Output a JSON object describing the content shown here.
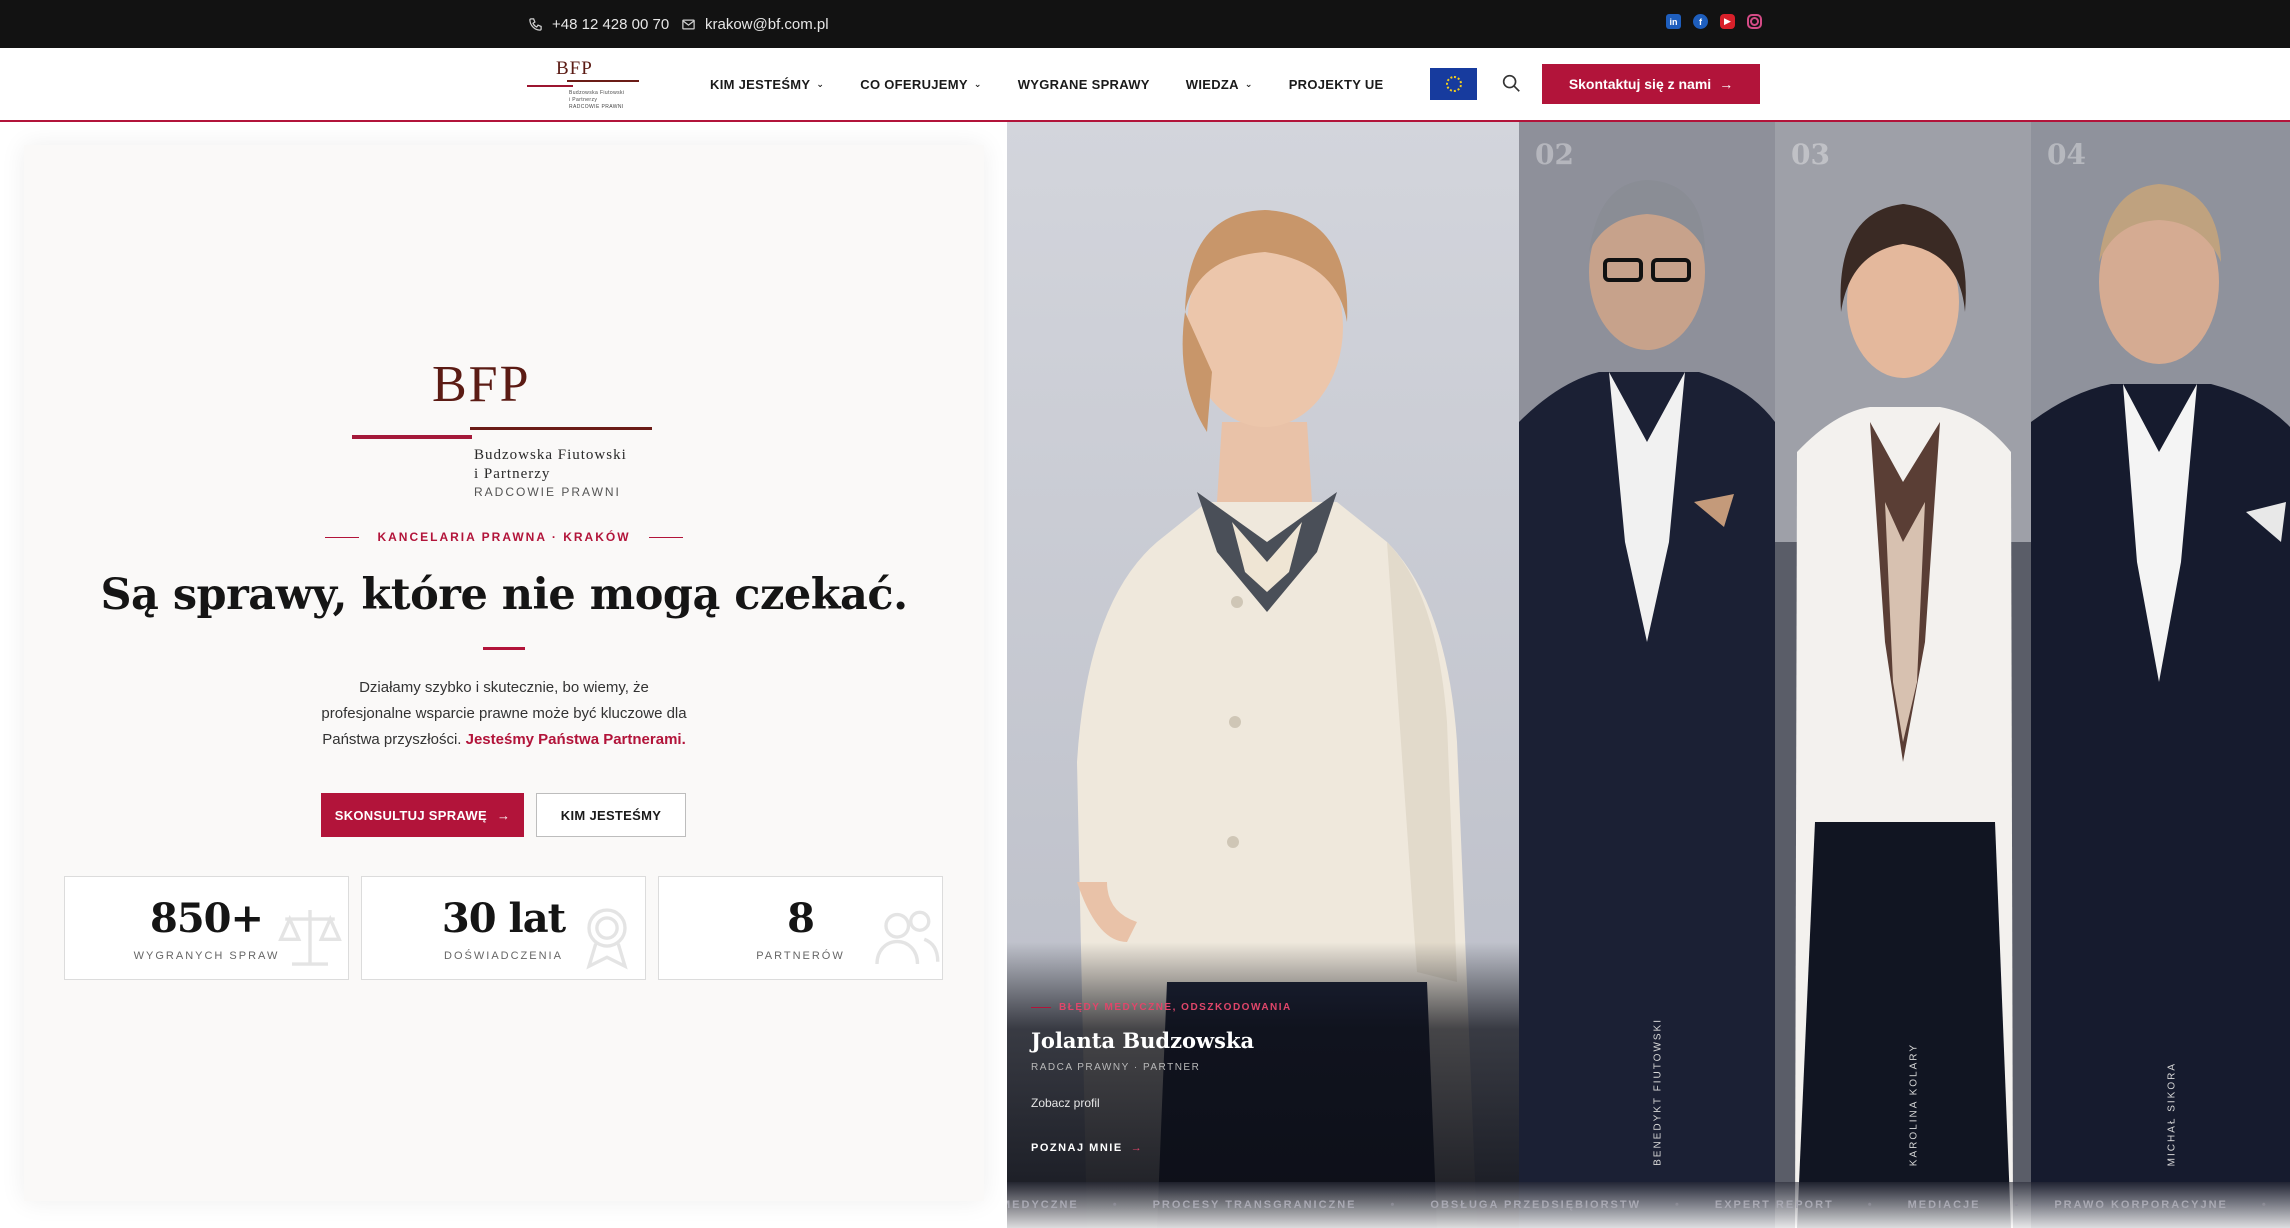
{
  "topbar": {
    "phone": "+48 12 428 00 70",
    "email": "krakow@bf.com.pl",
    "socials": [
      "linkedin-icon",
      "facebook-icon",
      "youtube-icon",
      "instagram-icon"
    ]
  },
  "nav": {
    "logo_mono": "BFP",
    "items": [
      {
        "label": "KIM JESTEŚMY",
        "dropdown": true
      },
      {
        "label": "CO OFERUJEMY",
        "dropdown": true
      },
      {
        "label": "WYGRANE SPRAWY",
        "dropdown": false
      },
      {
        "label": "WIEDZA",
        "dropdown": true
      },
      {
        "label": "PROJEKTY UE",
        "dropdown": false
      }
    ],
    "cta_label": "Skontaktuj się z nami"
  },
  "hero": {
    "logo_mono": "BFP",
    "logo_name1": "Budzowska Fiutowski",
    "logo_name2": "i Partnerzy",
    "logo_name3": "RADCOWIE PRAWNI",
    "eyebrow": "KANCELARIA PRAWNA · KRAKÓW",
    "headline": "Są sprawy, które nie mogą czekać.",
    "lead_text": "Działamy szybko i skutecznie, bo wiemy, że profesjonalne wsparcie prawne może być kluczowe dla Państwa przyszłości. ",
    "lead_highlight": "Jesteśmy Państwa Partnerami.",
    "btn_primary": "SKONSULTUJ SPRAWĘ",
    "btn_secondary": "KIM JESTEŚMY",
    "stats": [
      {
        "value": "850+",
        "label": "WYGRANYCH SPRAW",
        "icon": "scales-icon"
      },
      {
        "value": "30 lat",
        "label": "DOŚWIADCZENIA",
        "icon": "award-icon"
      },
      {
        "value": "8",
        "label": "PARTNERÓW",
        "icon": "users-icon"
      }
    ]
  },
  "team": {
    "featured": {
      "specialty": "BŁĘDY MEDYCZNE, ODSZKODOWANIA",
      "name": "Jolanta Budzowska",
      "role": "RADCA PRAWNY · PARTNER",
      "link": "Zobacz profil",
      "more": "POZNAJ MNIE"
    },
    "members": [
      {
        "number": "02",
        "name": "BENEDYKT FIUTOWSKI"
      },
      {
        "number": "03",
        "name": "KAROLINA KOLARY"
      },
      {
        "number": "04",
        "name": "MICHAŁ SIKORA"
      }
    ],
    "ticker": [
      "MEDYCZNE",
      "PROCESY TRANSGRANICZNE",
      "OBSŁUGA PRZEDSIĘBIORSTW",
      "EXPERT REPORT",
      "MEDIACJE",
      "PRAWO KORPORACYJNE"
    ]
  },
  "colors": {
    "accent": "#b2143a",
    "logo_brown": "#5b1b14",
    "topbar": "#121212"
  }
}
